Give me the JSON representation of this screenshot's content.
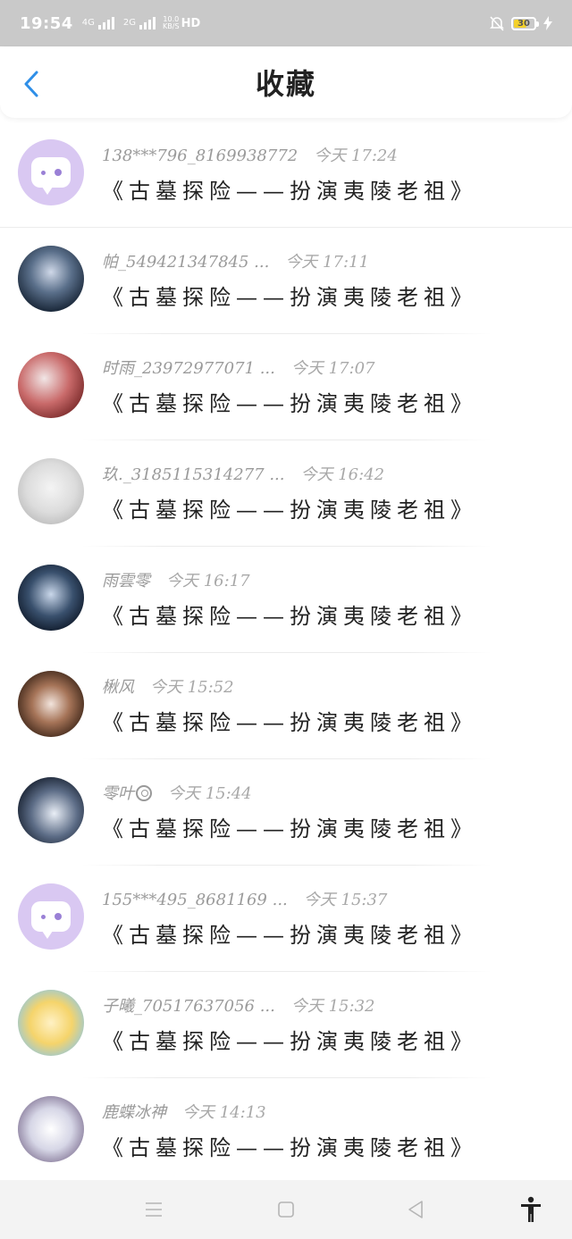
{
  "status_bar": {
    "time": "19:54",
    "net1": "4G",
    "net2": "2G",
    "speed_value": "10.0",
    "speed_unit": "KB/S",
    "hd": "HD",
    "battery": "30"
  },
  "header": {
    "title": "收藏"
  },
  "items": [
    {
      "name": "138***796_8169938772",
      "time": "今天 17:24",
      "message": "《古墓探险——扮演夷陵老祖》",
      "avatar": "default-bubble"
    },
    {
      "name": "帕_549421347845 ...",
      "time": "今天 17:11",
      "message": "《古墓探险——扮演夷陵老祖》",
      "avatar": "photo"
    },
    {
      "name": "时雨_23972977071 ...",
      "time": "今天 17:07",
      "message": "《古墓探险——扮演夷陵老祖》",
      "avatar": "photo"
    },
    {
      "name": "玖._3185115314277 ...",
      "time": "今天 16:42",
      "message": "《古墓探险——扮演夷陵老祖》",
      "avatar": "photo"
    },
    {
      "name": "雨雲零",
      "time": "今天 16:17",
      "message": "《古墓探险——扮演夷陵老祖》",
      "avatar": "photo"
    },
    {
      "name": "楸风",
      "time": "今天 15:52",
      "message": "《古墓探险——扮演夷陵老祖》",
      "avatar": "photo"
    },
    {
      "name": "零叶",
      "time": "今天 15:44",
      "message": "《古墓探险——扮演夷陵老祖》",
      "avatar": "photo"
    },
    {
      "name": "155***495_8681169 ...",
      "time": "今天 15:37",
      "message": "《古墓探险——扮演夷陵老祖》",
      "avatar": "default-bubble"
    },
    {
      "name": "子曦_70517637056 ...",
      "time": "今天 15:32",
      "message": "《古墓探险——扮演夷陵老祖》",
      "avatar": "photo"
    },
    {
      "name": "鹿蝶冰神",
      "time": "今天 14:13",
      "message": "《古墓探险——扮演夷陵老祖》",
      "avatar": "photo"
    }
  ],
  "colors": {
    "accent": "#2f8fe8",
    "default_avatar_bg": "#d9c8f2",
    "status_bar_bg": "#c9c9c9"
  },
  "icons": {
    "back": "back-chevron-icon",
    "nav_menu": "menu-icon",
    "nav_home": "home-icon",
    "nav_back": "back-triangle-icon",
    "accessibility": "accessibility-icon"
  }
}
